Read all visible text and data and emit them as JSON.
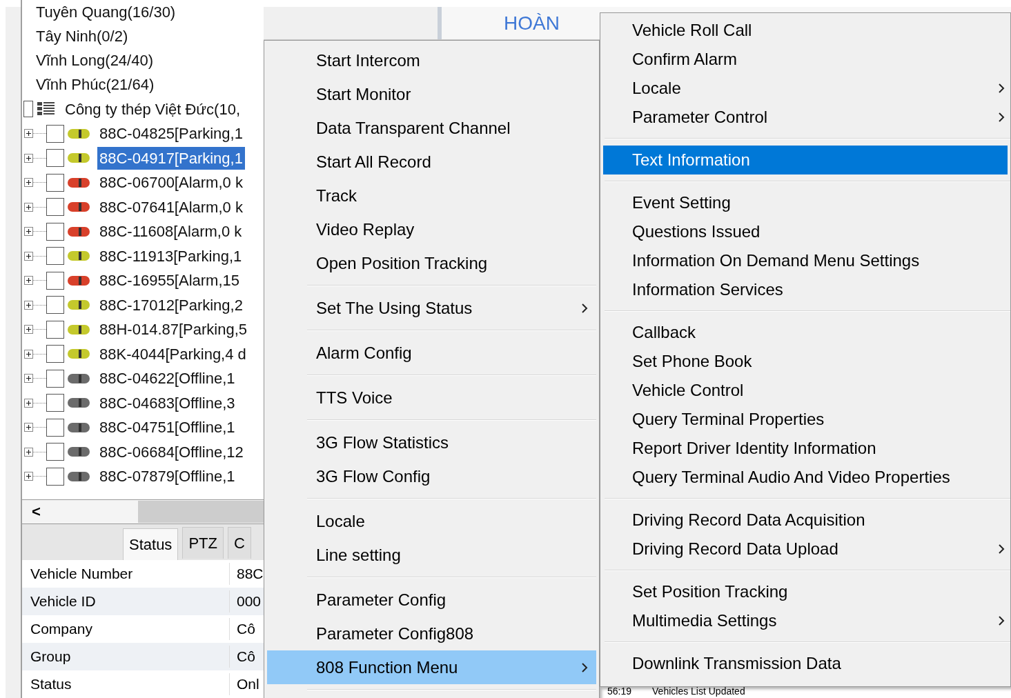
{
  "tree": {
    "groups": [
      "Tuyên Quang(16/30)",
      "Tây Ninh(0/2)",
      "Vĩnh Long(24/40)",
      "Vĩnh Phúc(21/64)"
    ],
    "company": {
      "label": "Công ty thép Việt Đức(10,",
      "checked": false
    },
    "vehicles": [
      {
        "label": "88C-04825[Parking,1",
        "color": "#c4c92c",
        "checked": false,
        "selected": false
      },
      {
        "label": "88C-04917[Parking,1",
        "color": "#c4c92c",
        "checked": false,
        "selected": true
      },
      {
        "label": "88C-06700[Alarm,0 k",
        "color": "#d8402a",
        "checked": false,
        "selected": false
      },
      {
        "label": "88C-07641[Alarm,0 k",
        "color": "#d8402a",
        "checked": false,
        "selected": false
      },
      {
        "label": "88C-11608[Alarm,0 k",
        "color": "#d8402a",
        "checked": false,
        "selected": false
      },
      {
        "label": "88C-11913[Parking,1",
        "color": "#c4c92c",
        "checked": false,
        "selected": false
      },
      {
        "label": "88C-16955[Alarm,15",
        "color": "#d8402a",
        "checked": false,
        "selected": false
      },
      {
        "label": "88C-17012[Parking,2",
        "color": "#c4c92c",
        "checked": false,
        "selected": false
      },
      {
        "label": "88H-014.87[Parking,5",
        "color": "#c4c92c",
        "checked": false,
        "selected": false
      },
      {
        "label": "88K-4044[Parking,4 d",
        "color": "#c4c92c",
        "checked": false,
        "selected": false
      },
      {
        "label": "88C-04622[Offline,1",
        "color": "#6b6b6b",
        "checked": false,
        "selected": false
      },
      {
        "label": "88C-04683[Offline,3",
        "color": "#6b6b6b",
        "checked": false,
        "selected": false
      },
      {
        "label": "88C-04751[Offline,1",
        "color": "#6b6b6b",
        "checked": false,
        "selected": false
      },
      {
        "label": "88C-06684[Offline,12",
        "color": "#6b6b6b",
        "checked": false,
        "selected": false
      },
      {
        "label": "88C-07879[Offline,1",
        "color": "#6b6b6b",
        "checked": false,
        "selected": false
      }
    ]
  },
  "scrollbar": {
    "left_arrow": "<"
  },
  "tabs": [
    {
      "label": "Status",
      "selected": true
    },
    {
      "label": "PTZ",
      "selected": false
    },
    {
      "label": "C",
      "selected": false
    }
  ],
  "properties": [
    {
      "name": "Vehicle Number",
      "value": "88C"
    },
    {
      "name": "Vehicle ID",
      "value": "000"
    },
    {
      "name": "Company",
      "value": "Cô"
    },
    {
      "name": "Group",
      "value": "Cô"
    },
    {
      "name": "Status",
      "value": "Onl"
    }
  ],
  "map": {
    "label": "HOÀN"
  },
  "log": {
    "time": "56:19",
    "message": "Vehicles List Updated"
  },
  "menu": [
    {
      "kind": "item",
      "label": "Start Intercom",
      "submenu": false,
      "selected": false
    },
    {
      "kind": "item",
      "label": "Start Monitor",
      "submenu": false,
      "selected": false
    },
    {
      "kind": "item",
      "label": "Data Transparent Channel",
      "submenu": false,
      "selected": false
    },
    {
      "kind": "item",
      "label": "Start All Record",
      "submenu": false,
      "selected": false
    },
    {
      "kind": "item",
      "label": "Track",
      "submenu": false,
      "selected": false
    },
    {
      "kind": "item",
      "label": "Video Replay",
      "submenu": false,
      "selected": false
    },
    {
      "kind": "item",
      "label": "Open Position Tracking",
      "submenu": false,
      "selected": false
    },
    {
      "kind": "separator"
    },
    {
      "kind": "item",
      "label": "Set The Using Status",
      "submenu": true,
      "selected": false
    },
    {
      "kind": "separator"
    },
    {
      "kind": "item",
      "label": "Alarm Config",
      "submenu": false,
      "selected": false
    },
    {
      "kind": "separator"
    },
    {
      "kind": "item",
      "label": "TTS Voice",
      "submenu": false,
      "selected": false
    },
    {
      "kind": "separator"
    },
    {
      "kind": "item",
      "label": "3G Flow Statistics",
      "submenu": false,
      "selected": false
    },
    {
      "kind": "item",
      "label": "3G Flow Config",
      "submenu": false,
      "selected": false
    },
    {
      "kind": "separator"
    },
    {
      "kind": "item",
      "label": "Locale",
      "submenu": false,
      "selected": false
    },
    {
      "kind": "item",
      "label": "Line setting",
      "submenu": false,
      "selected": false
    },
    {
      "kind": "separator"
    },
    {
      "kind": "item",
      "label": "Parameter Config",
      "submenu": false,
      "selected": false
    },
    {
      "kind": "item",
      "label": "Parameter Config808",
      "submenu": false,
      "selected": false
    },
    {
      "kind": "item",
      "label": "808 Function Menu",
      "submenu": true,
      "selected": true
    },
    {
      "kind": "separator"
    }
  ],
  "submenu": [
    {
      "kind": "item",
      "label": "Vehicle Roll Call",
      "submenu": false,
      "selected": false
    },
    {
      "kind": "item",
      "label": "Confirm Alarm",
      "submenu": false,
      "selected": false
    },
    {
      "kind": "item",
      "label": "Locale",
      "submenu": true,
      "selected": false
    },
    {
      "kind": "item",
      "label": "Parameter Control",
      "submenu": true,
      "selected": false
    },
    {
      "kind": "separator"
    },
    {
      "kind": "item",
      "label": "Text Information",
      "submenu": false,
      "selected": true
    },
    {
      "kind": "separator"
    },
    {
      "kind": "item",
      "label": "Event Setting",
      "submenu": false,
      "selected": false
    },
    {
      "kind": "item",
      "label": "Questions Issued",
      "submenu": false,
      "selected": false
    },
    {
      "kind": "item",
      "label": "Information On Demand Menu Settings",
      "submenu": false,
      "selected": false
    },
    {
      "kind": "item",
      "label": "Information Services",
      "submenu": false,
      "selected": false
    },
    {
      "kind": "separator"
    },
    {
      "kind": "item",
      "label": "Callback",
      "submenu": false,
      "selected": false
    },
    {
      "kind": "item",
      "label": "Set Phone Book",
      "submenu": false,
      "selected": false
    },
    {
      "kind": "item",
      "label": "Vehicle Control",
      "submenu": false,
      "selected": false
    },
    {
      "kind": "item",
      "label": "Query Terminal Properties",
      "submenu": false,
      "selected": false
    },
    {
      "kind": "item",
      "label": "Report Driver Identity Information",
      "submenu": false,
      "selected": false
    },
    {
      "kind": "item",
      "label": "Query Terminal Audio And Video Properties",
      "submenu": false,
      "selected": false
    },
    {
      "kind": "separator"
    },
    {
      "kind": "item",
      "label": "Driving Record Data Acquisition",
      "submenu": false,
      "selected": false
    },
    {
      "kind": "item",
      "label": "Driving Record Data Upload",
      "submenu": true,
      "selected": false
    },
    {
      "kind": "separator"
    },
    {
      "kind": "item",
      "label": "Set Position Tracking",
      "submenu": false,
      "selected": false
    },
    {
      "kind": "item",
      "label": "Multimedia Settings",
      "submenu": true,
      "selected": false
    },
    {
      "kind": "separator"
    },
    {
      "kind": "item",
      "label": "Downlink Transmission Data",
      "submenu": false,
      "selected": false
    }
  ]
}
